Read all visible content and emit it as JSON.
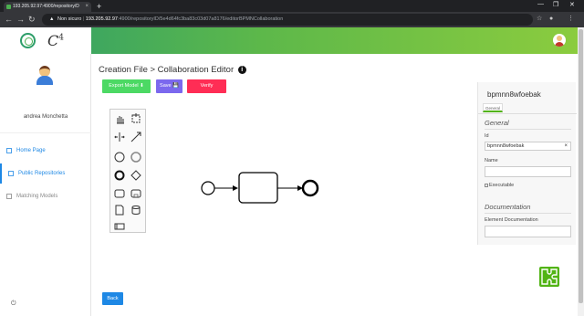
{
  "browser": {
    "tab_title": "193.205.92.97:4900/repository/D",
    "tab_close": "×",
    "new_tab": "+",
    "security_label": "Non sicuro",
    "url_host": "193.205.92.97",
    "url_path": ":4900/repositoryID/5e4d64fc3ba83c03d07a8176/editorBPMNCollaboration",
    "win_min": "—",
    "win_max": "❐",
    "win_close": "✕"
  },
  "header": {
    "logo_text": "C",
    "logo_sup": "4"
  },
  "sidebar": {
    "username": "andrea Monchetta",
    "items": [
      {
        "label": "Home Page",
        "icon": "document-icon"
      },
      {
        "label": "Public Repositories",
        "icon": "document-icon"
      },
      {
        "label": "Matching Models",
        "icon": "document-icon"
      }
    ],
    "power_icon": "⏻"
  },
  "main": {
    "title": "Creation File > Collaboration Editor",
    "info_glyph": "i",
    "buttons": {
      "export": "Export Model ⬇",
      "save": "Save 💾",
      "verify": "Verify"
    },
    "back": "Back"
  },
  "properties": {
    "element_id": "bpmnn8wfoebak",
    "tab": "General",
    "group_general": "General",
    "id_label": "Id",
    "id_value": "bpmnn8wfoebak",
    "name_label": "Name",
    "name_value": "",
    "executable_label": "Executable",
    "group_documentation": "Documentation",
    "doc_label": "Element Documentation",
    "doc_value": ""
  },
  "colors": {
    "accent_green": "#52b415",
    "export_btn": "#4cd964",
    "save_btn": "#7b68ee",
    "verify_btn": "#ff2d55",
    "link_blue": "#1e88e5"
  }
}
